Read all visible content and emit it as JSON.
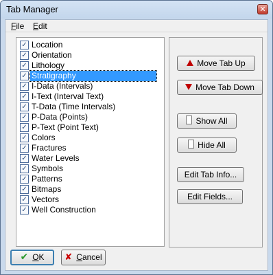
{
  "window": {
    "title": "Tab Manager",
    "close_icon": "close-icon",
    "close_glyph": "✕"
  },
  "menu": {
    "file_accel": "F",
    "file_rest": "ile",
    "edit_accel": "E",
    "edit_rest": "dit"
  },
  "tabs": [
    {
      "label": "Location",
      "checked": true,
      "selected": false
    },
    {
      "label": "Orientation",
      "checked": true,
      "selected": false
    },
    {
      "label": "Lithology",
      "checked": true,
      "selected": false
    },
    {
      "label": "Stratigraphy",
      "checked": true,
      "selected": true
    },
    {
      "label": "I-Data (Intervals)",
      "checked": true,
      "selected": false
    },
    {
      "label": "I-Text (Interval Text)",
      "checked": true,
      "selected": false
    },
    {
      "label": "T-Data (Time Intervals)",
      "checked": true,
      "selected": false
    },
    {
      "label": "P-Data (Points)",
      "checked": true,
      "selected": false
    },
    {
      "label": "P-Text (Point Text)",
      "checked": true,
      "selected": false
    },
    {
      "label": "Colors",
      "checked": true,
      "selected": false
    },
    {
      "label": "Fractures",
      "checked": true,
      "selected": false
    },
    {
      "label": "Water Levels",
      "checked": true,
      "selected": false
    },
    {
      "label": "Symbols",
      "checked": true,
      "selected": false
    },
    {
      "label": "Patterns",
      "checked": true,
      "selected": false
    },
    {
      "label": "Bitmaps",
      "checked": true,
      "selected": false
    },
    {
      "label": "Vectors",
      "checked": true,
      "selected": false
    },
    {
      "label": "Well Construction",
      "checked": true,
      "selected": false
    }
  ],
  "buttons": {
    "move_up": "Move Tab Up",
    "move_down": "Move Tab Down",
    "show_all": "Show All",
    "hide_all": "Hide All",
    "edit_tab_info": "Edit Tab Info...",
    "edit_fields": "Edit Fields..."
  },
  "footer": {
    "ok_accel": "O",
    "ok_rest": "K",
    "cancel_accel": "C",
    "cancel_rest": "ancel"
  },
  "colors": {
    "selection": "#3399ff",
    "arrow": "#c00000",
    "ok_check": "#2e9a2e",
    "cancel_x": "#cc0000"
  }
}
